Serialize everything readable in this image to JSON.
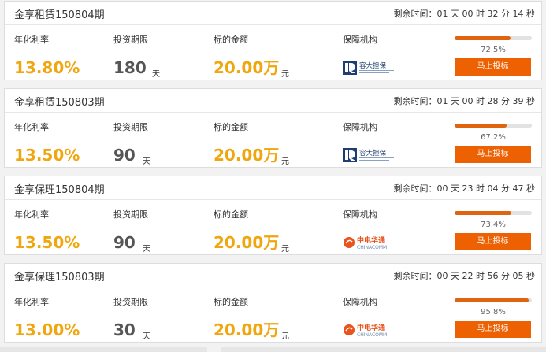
{
  "labels": {
    "rate": "年化利率",
    "term": "投资期限",
    "amount": "标的金额",
    "guarantor": "保障机构",
    "day_unit": "天",
    "yuan_unit": "元",
    "countdown_prefix": "剩余时间："
  },
  "colors": {
    "accent": "#f0a70f",
    "button": "#ed6103",
    "progress": "#e0630f"
  },
  "items": [
    {
      "title": "金享租赁150804期",
      "countdown": "01 天 00 时 32 分 14 秒",
      "rate": "13.80%",
      "term": "180",
      "amount": "20.00万",
      "guarantor_icon": "rongda-guarantee-logo",
      "guarantor_cn": "容大担保",
      "progress_value": 0.725,
      "progress_text": "72.5%",
      "button_label": "马上投标"
    },
    {
      "title": "金享租赁150803期",
      "countdown": "01 天 00 时 28 分 39 秒",
      "rate": "13.50%",
      "term": "90",
      "amount": "20.00万",
      "guarantor_icon": "rongda-guarantee-logo",
      "guarantor_cn": "容大担保",
      "progress_value": 0.672,
      "progress_text": "67.2%",
      "button_label": "马上投标"
    },
    {
      "title": "金享保理150804期",
      "countdown": "00 天 23 时 04 分 47 秒",
      "rate": "13.50%",
      "term": "90",
      "amount": "20.00万",
      "guarantor_icon": "chinacomm-logo",
      "guarantor_cn": "中电华通",
      "guarantor_en": "CHINACOMM",
      "progress_value": 0.734,
      "progress_text": "73.4%",
      "button_label": "马上投标"
    },
    {
      "title": "金享保理150803期",
      "countdown": "00 天 22 时 56 分 05 秒",
      "rate": "13.00%",
      "term": "30",
      "amount": "20.00万",
      "guarantor_icon": "chinacomm-logo",
      "guarantor_cn": "中电华通",
      "guarantor_en": "CHINACOMM",
      "progress_value": 0.958,
      "progress_text": "95.8%",
      "button_label": "马上投标"
    }
  ]
}
